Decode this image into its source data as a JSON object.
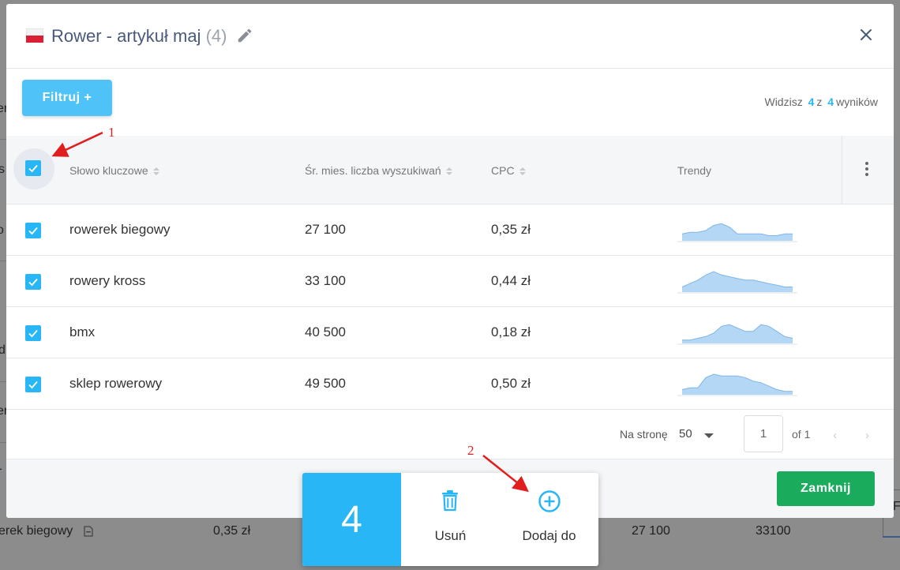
{
  "modal": {
    "title": "Rower - artykuł maj",
    "title_count": "(4)",
    "filter_button": "Filtruj +",
    "results": {
      "prefix": "Widzisz",
      "shown": "4",
      "middle": "z",
      "total": "4",
      "suffix": "wyników"
    }
  },
  "table": {
    "columns": {
      "keyword": "Słowo kluczowe",
      "searches": "Śr. mies. liczba wyszukiwań",
      "cpc": "CPC",
      "trends": "Trendy"
    },
    "rows": [
      {
        "keyword": "rowerek biegowy",
        "searches": "27 100",
        "cpc": "0,35 zł",
        "checked": true,
        "trend": [
          4,
          5,
          5,
          6,
          9,
          10,
          8,
          4,
          4,
          4,
          4,
          3,
          3,
          4,
          4
        ]
      },
      {
        "keyword": "rowery kross",
        "searches": "33 100",
        "cpc": "0,44 zł",
        "checked": true,
        "trend": [
          3,
          5,
          7,
          10,
          12,
          10,
          9,
          8,
          7,
          7,
          6,
          5,
          4,
          3,
          3
        ]
      },
      {
        "keyword": "bmx",
        "searches": "40 500",
        "cpc": "0,18 zł",
        "checked": true,
        "trend": [
          2,
          2,
          3,
          4,
          6,
          10,
          11,
          9,
          7,
          7,
          11,
          10,
          7,
          4,
          3
        ]
      },
      {
        "keyword": "sklep rowerowy",
        "searches": "49 500",
        "cpc": "0,50 zł",
        "checked": true,
        "trend": [
          3,
          4,
          4,
          10,
          12,
          11,
          11,
          11,
          10,
          8,
          7,
          5,
          3,
          2,
          2
        ]
      }
    ]
  },
  "pagination": {
    "per_page_label": "Na stronę",
    "per_page_value": "50",
    "page": "1",
    "of_label": "of 1",
    "prev": "‹",
    "next": "›"
  },
  "footer": {
    "close_button": "Zamknij"
  },
  "action_bar": {
    "count": "4",
    "delete_label": "Usuń",
    "add_label": "Dodaj do"
  },
  "annotations": {
    "one": "1",
    "two": "2"
  },
  "background": {
    "row_keyword": "erek biegowy",
    "row_cpc": "0,35 zł",
    "row_searches": "27 100",
    "row_other": "33100",
    "frag_er": "er",
    "frag_s": "s",
    "frag_o": "o",
    "frag_d": "d",
    "frag_er2": "er",
    "frag_r": "r",
    "right_tab": "F"
  },
  "colors": {
    "accent": "#29b6f6",
    "filter": "#4fc3f7",
    "close": "#1aab5c",
    "title": "#495a7c",
    "annotation": "#e01e1e"
  },
  "icons": [
    "poland-flag-icon",
    "pencil-icon",
    "close-icon",
    "sort-icon",
    "kebab-menu-icon",
    "checkbox-icon",
    "trash-icon",
    "plus-circle-icon",
    "dropdown-caret-icon",
    "document-icon"
  ]
}
